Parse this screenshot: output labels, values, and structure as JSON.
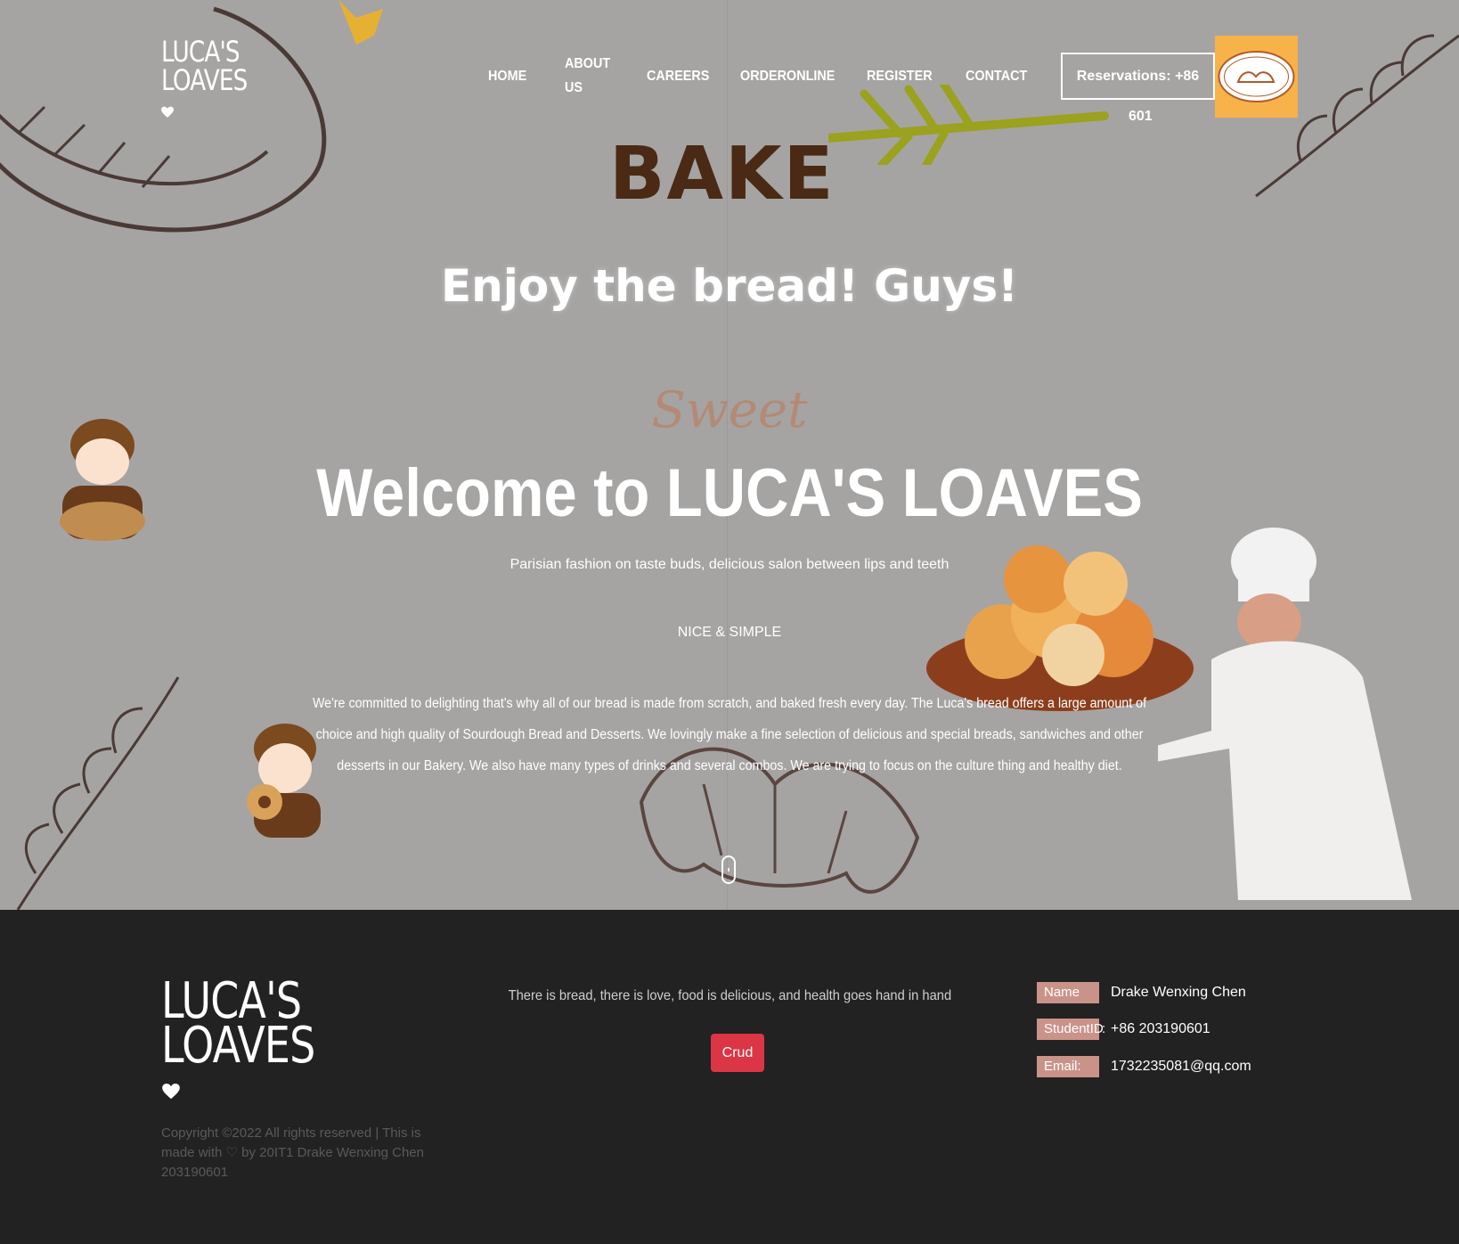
{
  "header": {
    "logo_line1": "LUCA'S",
    "logo_line2": "LOAVES",
    "nav": [
      "HOME",
      "ABOUT US",
      "CAREERS",
      "ORDERONLINE",
      "REGISTER",
      "CONTACT"
    ],
    "reservation_label": "Reservations: +86",
    "reservation_tail": "601"
  },
  "hero": {
    "bake_text": "BAKE",
    "headline": "Enjoy the bread! Guys!",
    "script_word": "Sweet",
    "welcome": "Welcome to LUCA'S LOAVES",
    "tagline": "Parisian fashion on taste buds, delicious salon between lips and teeth",
    "subheading": "NICE & SIMPLE",
    "description": "We're committed to delighting that's why all of our bread is made from scratch, and baked fresh every day. The Luca's bread offers a large amount of choice and high quality of Sourdough Bread and Desserts. We lovingly make a fine selection of delicious and special breads, sandwiches and other desserts in our Bakery. We also have many types of drinks and several combos. We are trying to focus on the culture thing and healthy diet."
  },
  "footer": {
    "logo_line1": "LUCA'S",
    "logo_line2": "LOAVES",
    "copyright": "Copyright ©2022 All rights reserved | This is made with ♡ by 20IT1 Drake Wenxing Chen 203190601",
    "motto": "There is bread, there is love, food is delicious, and health goes hand in hand",
    "crud_button": "Crud",
    "info": [
      {
        "label": "Name",
        "value": "Drake Wenxing Chen"
      },
      {
        "label": "StudentID",
        "value": "+86 203190601"
      },
      {
        "label": "Email:",
        "value": "1732235081@qq.com"
      }
    ]
  },
  "colors": {
    "hero_bg": "#a5a4a3",
    "footer_bg": "#222222",
    "accent_red": "#dc3545",
    "label_pink": "#c9938a",
    "badge_orange": "#f8b24a"
  }
}
